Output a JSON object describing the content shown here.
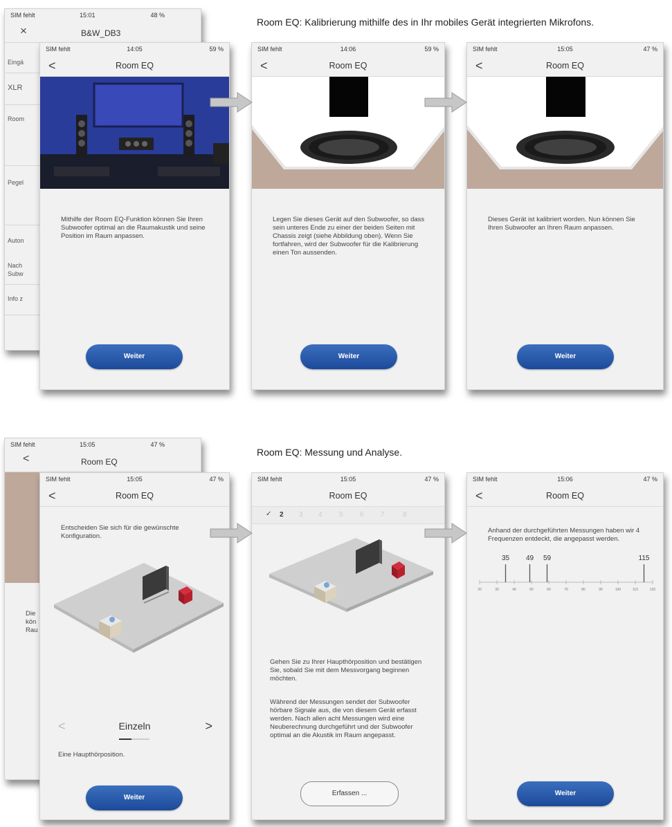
{
  "captions": {
    "top": "Room EQ: Kalibrierung mithilfe des in Ihr mobiles Gerät integrierten Mikrofons.",
    "bottom": "Room EQ: Messung und Analyse."
  },
  "colors": {
    "button": "#2556a8",
    "arrow": "#c7c7c7",
    "screen_bg": "#f1f1f1",
    "sub_red": "#b8202e",
    "floor_brown": "#bda89a"
  },
  "bg_screen1": {
    "carrier": "SIM fehlt",
    "time": "15:01",
    "battery": "48 %",
    "close": "×",
    "title": "B&W_DB3",
    "items": [
      "Eingä",
      "XLR",
      "Room",
      "Pegel",
      "Auton",
      "Nach",
      "Subw",
      "Info z"
    ]
  },
  "screen_intro": {
    "carrier": "SIM fehlt",
    "time": "14:05",
    "battery": "59 %",
    "back": "<",
    "title": "Room EQ",
    "text": "Mithilfe der Room EQ-Funktion können Sie Ihren Subwoofer optimal an die Raumakustik und seine Position im Raum anpassen.",
    "button": "Weiter"
  },
  "screen_place": {
    "carrier": "SIM fehlt",
    "time": "14:06",
    "battery": "59 %",
    "back": "<",
    "title": "Room EQ",
    "text": "Legen Sie dieses Gerät auf den Subwoofer, so dass sein unteres Ende zu einer der beiden Seiten mit Chassis zeigt (siehe Abbildung oben). Wenn Sie fortfahren, wird der Subwoofer für die Kalibrierung einen Ton aussenden.",
    "button": "Weiter"
  },
  "screen_done": {
    "carrier": "SIM fehlt",
    "time": "15:05",
    "battery": "47 %",
    "back": "<",
    "title": "Room EQ",
    "text": "Dieses Gerät ist kalibriert worden. Nun können Sie Ihren Subwoofer an Ihren Raum anpassen.",
    "button": "Weiter"
  },
  "bg_screen2": {
    "carrier": "SIM fehlt",
    "time": "15:05",
    "battery": "47 %",
    "back": "<",
    "title": "Room EQ",
    "text": "Die\nkön\nRau"
  },
  "screen_config": {
    "carrier": "SIM fehlt",
    "time": "15:05",
    "battery": "47 %",
    "back": "<",
    "title": "Room EQ",
    "text": "Entscheiden Sie sich für die gewünschte Konfiguration.",
    "prev": "<",
    "next": ">",
    "option": "Einzeln",
    "option_desc": "Eine Haupthörposition.",
    "button": "Weiter"
  },
  "screen_measure": {
    "carrier": "SIM fehlt",
    "time": "15:05",
    "battery": "47 %",
    "title": "Room EQ",
    "steps": [
      "✓",
      "2",
      "3",
      "4",
      "5",
      "6",
      "7",
      "8"
    ],
    "text1": "Gehen Sie zu Ihrer Haupthörposition und bestätigen Sie, sobald Sie mit dem Messvorgang beginnen möchten.",
    "text2": "Während der Messungen sendet der Subwoofer hörbare Signale aus, die von diesem Gerät erfasst werden. Nach allen acht Messungen wird eine Neuberechnung durchgeführt und der Subwoofer optimal an die Akustik im Raum angepasst.",
    "button": "Erfassen ..."
  },
  "screen_result": {
    "carrier": "SIM fehlt",
    "time": "15:06",
    "battery": "47 %",
    "back": "<",
    "title": "Room EQ",
    "text": "Anhand der durchgeführten Messungen haben wir  4 Frequenzen entdeckt, die angepasst werden.",
    "freqs": [
      "35",
      "49",
      "59",
      "115"
    ],
    "freq_values": [
      35,
      49,
      59,
      115
    ],
    "axis_ticks": [
      "20",
      "30",
      "40",
      "50",
      "60",
      "70",
      "80",
      "90",
      "100",
      "110",
      "120"
    ],
    "button": "Weiter"
  }
}
